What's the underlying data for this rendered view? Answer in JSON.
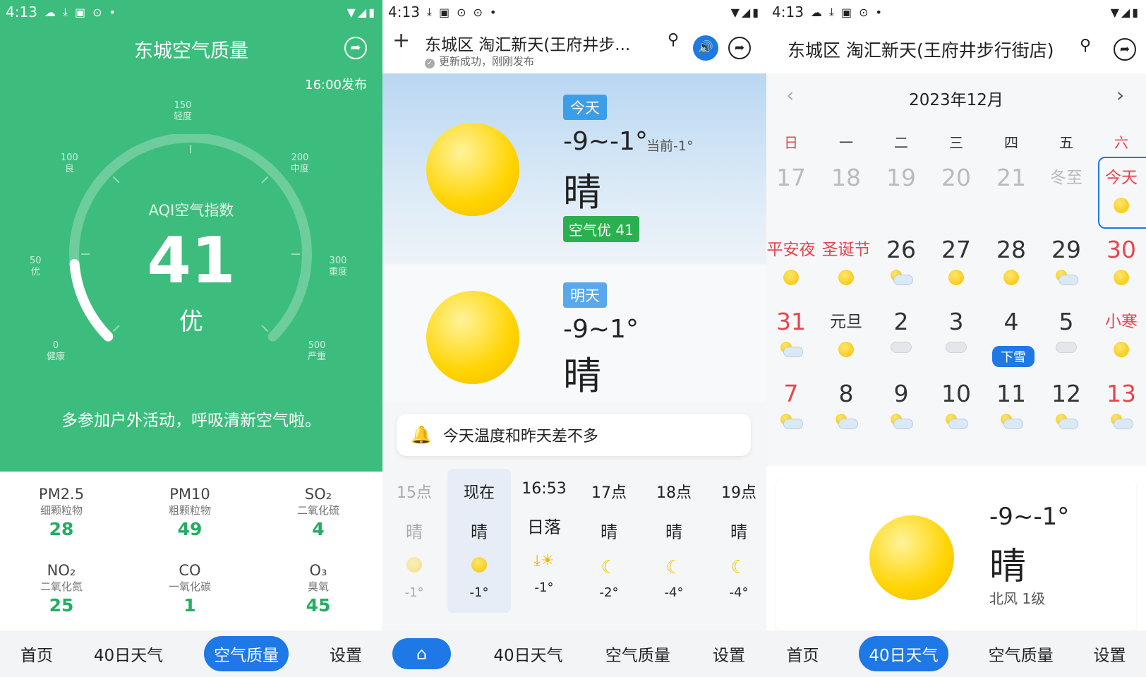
{
  "p1": {
    "time": "4:13",
    "title": "东城空气质量",
    "publish": "16:00发布",
    "aqi_label": "AQI空气指数",
    "aqi_value": "41",
    "aqi_level": "优",
    "aqi_fraction": 0.082,
    "advice": "多参加户外活动，呼吸清新空气啦。",
    "axis": [
      {
        "num": "0",
        "lvl": "健康"
      },
      {
        "num": "50",
        "lvl": "优"
      },
      {
        "num": "100",
        "lvl": "良"
      },
      {
        "num": "150",
        "lvl": "轻度"
      },
      {
        "num": "200",
        "lvl": "中度"
      },
      {
        "num": "300",
        "lvl": "重度"
      },
      {
        "num": "500",
        "lvl": "严重"
      }
    ],
    "pollutants": [
      {
        "name": "PM2.5",
        "sub": "细颗粒物",
        "value": "28"
      },
      {
        "name": "PM10",
        "sub": "粗颗粒物",
        "value": "49"
      },
      {
        "name": "SO₂",
        "sub": "二氧化硫",
        "value": "4"
      },
      {
        "name": "NO₂",
        "sub": "二氧化氮",
        "value": "25"
      },
      {
        "name": "CO",
        "sub": "一氧化碳",
        "value": "1"
      },
      {
        "name": "O₃",
        "sub": "臭氧",
        "value": "45"
      }
    ],
    "nav": [
      "首页",
      "40日天气",
      "空气质量",
      "设置"
    ],
    "accent": "#3dbd7d"
  },
  "p2": {
    "time": "4:13",
    "location": "东城区 淘汇新天(王府井步...",
    "update": "更新成功，刚刚发布",
    "today": {
      "tag": "今天",
      "range": "-9~-1°",
      "current": "当前-1°",
      "cond": "晴",
      "air": "空气优 41"
    },
    "tomorrow": {
      "tag": "明天",
      "range": "-9~1°",
      "cond": "晴"
    },
    "notice": "今天温度和昨天差不多",
    "hours": [
      {
        "t": "15点",
        "c": "晴",
        "v": "-1°"
      },
      {
        "t": "现在",
        "c": "晴",
        "v": "-1°"
      },
      {
        "t": "16:53",
        "c": "日落",
        "v": "-1°"
      },
      {
        "t": "17点",
        "c": "晴",
        "v": "-2°"
      },
      {
        "t": "18点",
        "c": "晴",
        "v": "-4°"
      },
      {
        "t": "19点",
        "c": "晴",
        "v": "-4°"
      }
    ],
    "nav": [
      "40日天气",
      "空气质量",
      "设置"
    ]
  },
  "p3": {
    "time": "4:13",
    "location": "东城区 淘汇新天(王府井步行街店)",
    "month": "2023年12月",
    "weekdays": [
      "日",
      "一",
      "二",
      "三",
      "四",
      "五",
      "六"
    ],
    "weeks": [
      [
        "17",
        "18",
        "19",
        "20",
        "21",
        "冬至",
        "今天"
      ],
      [
        "平安夜",
        "圣诞节",
        "26",
        "27",
        "28",
        "29",
        "30"
      ],
      [
        "31",
        "元旦",
        "2",
        "3",
        "4",
        "5",
        "小寒"
      ],
      [
        "7",
        "8",
        "9",
        "10",
        "11",
        "12",
        "13"
      ]
    ],
    "snow_badge": "下雪",
    "range": "-9~-1°",
    "cond": "晴",
    "wind": "北风 1级",
    "nav": [
      "首页",
      "40日天气",
      "空气质量",
      "设置"
    ]
  }
}
